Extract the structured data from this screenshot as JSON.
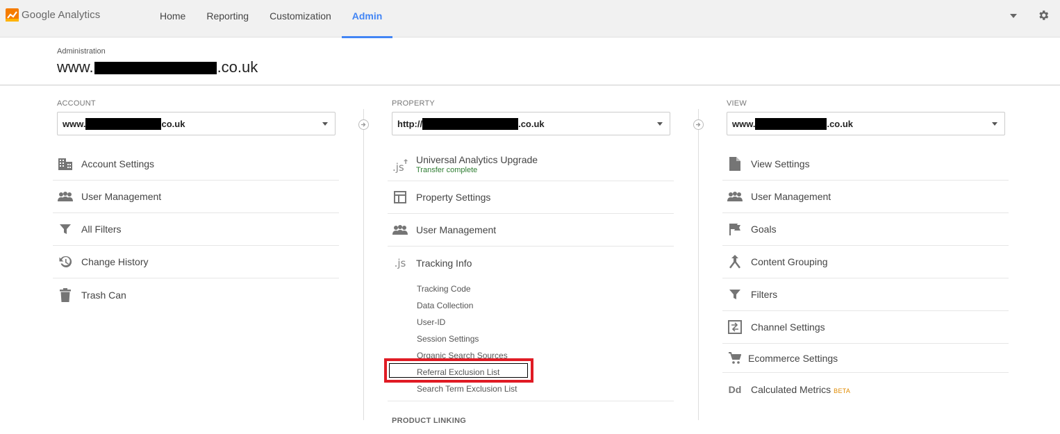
{
  "app": {
    "name": "Google Analytics"
  },
  "nav": {
    "items": [
      "Home",
      "Reporting",
      "Customization",
      "Admin"
    ],
    "active": "Admin"
  },
  "header": {
    "label": "Administration",
    "site_prefix": "www.",
    "site_suffix": ".co.uk"
  },
  "account": {
    "label": "ACCOUNT",
    "selected_prefix": "www.",
    "selected_suffix": "co.uk",
    "items": [
      {
        "label": "Account Settings",
        "icon": "building-icon"
      },
      {
        "label": "User Management",
        "icon": "people-icon"
      },
      {
        "label": "All Filters",
        "icon": "filter-icon"
      },
      {
        "label": "Change History",
        "icon": "history-icon"
      },
      {
        "label": "Trash Can",
        "icon": "trash-icon"
      }
    ]
  },
  "property": {
    "label": "PROPERTY",
    "selected_prefix": "http://",
    "selected_suffix": ".co.uk",
    "items": [
      {
        "label": "Universal Analytics Upgrade",
        "sublabel": "Transfer complete",
        "icon": "js-upgrade-icon"
      },
      {
        "label": "Property Settings",
        "icon": "layout-icon"
      },
      {
        "label": "User Management",
        "icon": "people-icon"
      },
      {
        "label": "Tracking Info",
        "icon": "js-icon"
      }
    ],
    "tracking_sub": [
      "Tracking Code",
      "Data Collection",
      "User-ID",
      "Session Settings",
      "Organic Search Sources",
      "Referral Exclusion List",
      "Search Term Exclusion List"
    ],
    "next_section": "PRODUCT LINKING",
    "js_text": ".js",
    "highlight_color": "#e01b24"
  },
  "view": {
    "label": "VIEW",
    "selected_prefix": "www.",
    "selected_suffix": ".co.uk",
    "items": [
      {
        "label": "View Settings",
        "icon": "document-icon"
      },
      {
        "label": "User Management",
        "icon": "people-icon"
      },
      {
        "label": "Goals",
        "icon": "flag-icon"
      },
      {
        "label": "Content Grouping",
        "icon": "grouping-icon"
      },
      {
        "label": "Filters",
        "icon": "filter-icon"
      },
      {
        "label": "Channel Settings",
        "icon": "channel-icon"
      },
      {
        "label": "Ecommerce Settings",
        "icon": "cart-icon"
      },
      {
        "label": "Calculated Metrics",
        "badge": "BETA",
        "icon": "dd-icon"
      }
    ],
    "dd_text": "Dd"
  },
  "colors": {
    "accent": "#4285f4",
    "highlight": "#e01b24",
    "success": "#2e7d32",
    "beta": "#e08a00"
  }
}
